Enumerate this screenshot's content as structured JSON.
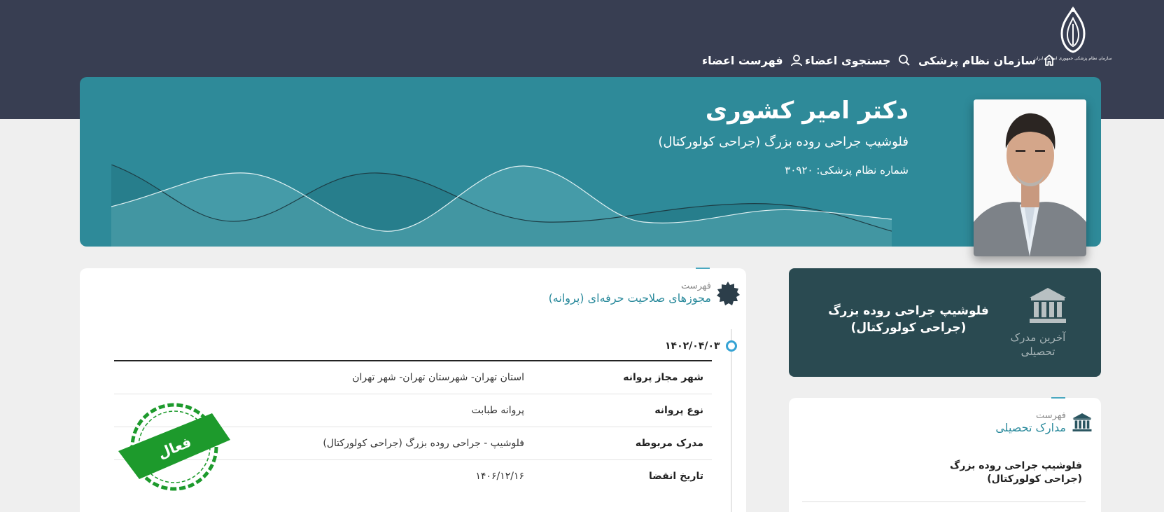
{
  "header": {
    "logo_caption": "سازمان نظام پزشکی جمهوری اسلامی ایران",
    "nav": [
      {
        "label": "سازمان نظام پزشکی",
        "icon": "home-icon"
      },
      {
        "label": "جستجوی اعضاء",
        "icon": "search-icon"
      },
      {
        "label": "فهرست اعضاء",
        "icon": "user-icon"
      }
    ]
  },
  "profile": {
    "name": "دکتر امیر کشوری",
    "specialty": "فلوشیپ جراحی روده بزرگ (جراحی کولورکتال)",
    "number_text": "شماره نظام پزشکی: ۳۰۹۲۰"
  },
  "latest_degree": {
    "label": "آخرین مدرک تحصیلی",
    "title": "فلوشیپ جراحی روده بزرگ (جراحی کولورکتال)"
  },
  "licenses": {
    "small": "فهرست",
    "title": "مجوزهای صلاحیت حرفه‌ای (پروانه)",
    "date": "۱۴۰۲/۰۴/۰۳",
    "rows": [
      {
        "key": "شهر مجاز پروانه",
        "value": "استان تهران- شهرستان تهران- شهر تهران"
      },
      {
        "key": "نوع پروانه",
        "value": "پروانه طبابت"
      },
      {
        "key": "مدرک مربوطه",
        "value": "فلوشیپ - جراحی روده بزرگ (جراحی کولورکتال)"
      },
      {
        "key": "تاریخ انقضا",
        "value": "۱۴۰۶/۱۲/۱۶"
      }
    ],
    "stamp": "فعال"
  },
  "education": {
    "small": "فهرست",
    "title": "مدارک تحصیلی",
    "items": [
      "فلوشیپ جراحی روده بزرگ (جراحی کولورکتال)"
    ]
  },
  "colors": {
    "topbar": "#383e52",
    "banner": "#2e8a99",
    "dark_card": "#2a4a51",
    "accent": "#2a8a9c",
    "stamp": "#1d9a2c"
  }
}
